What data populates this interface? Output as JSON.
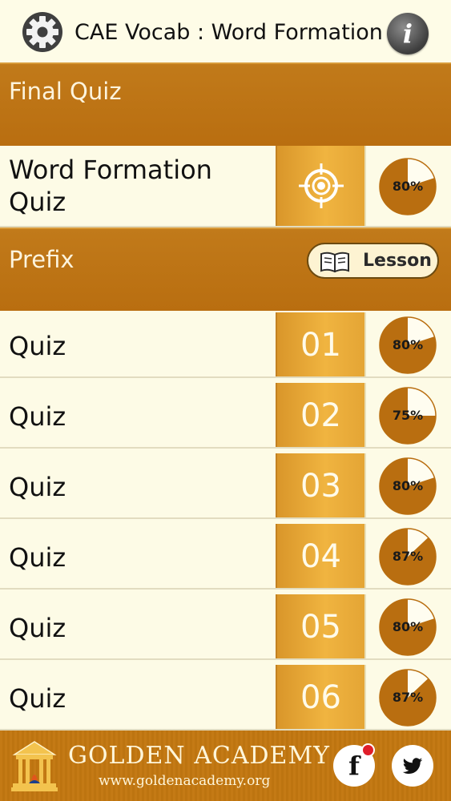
{
  "header": {
    "title": "CAE Vocab : Word Formation",
    "settings_icon": "gear-icon",
    "info_icon": "info-icon",
    "info_glyph": "i"
  },
  "final_section": {
    "label": "Final Quiz",
    "item": {
      "name_line1": "Word Formation",
      "name_line2": "Quiz",
      "icon": "target-icon",
      "score": 80,
      "score_label": "80%"
    }
  },
  "prefix_section": {
    "label": "Prefix",
    "lesson_button": "Lesson"
  },
  "quizzes": [
    {
      "name": "Quiz",
      "number": "01",
      "score": 80,
      "score_label": "80%"
    },
    {
      "name": "Quiz",
      "number": "02",
      "score": 75,
      "score_label": "75%"
    },
    {
      "name": "Quiz",
      "number": "03",
      "score": 80,
      "score_label": "80%"
    },
    {
      "name": "Quiz",
      "number": "04",
      "score": 87,
      "score_label": "87%"
    },
    {
      "name": "Quiz",
      "number": "05",
      "score": 80,
      "score_label": "80%"
    },
    {
      "name": "Quiz",
      "number": "06",
      "score": 87,
      "score_label": "87%"
    }
  ],
  "footer": {
    "brand": "GOLDEN ACADEMY",
    "url": "www.goldenacademy.org",
    "facebook_glyph": "f",
    "colors": {
      "accent": "#c17a1a",
      "pie_fill": "#b96e10",
      "number_cell": "#f0b440",
      "background": "#fdfbe6"
    }
  }
}
